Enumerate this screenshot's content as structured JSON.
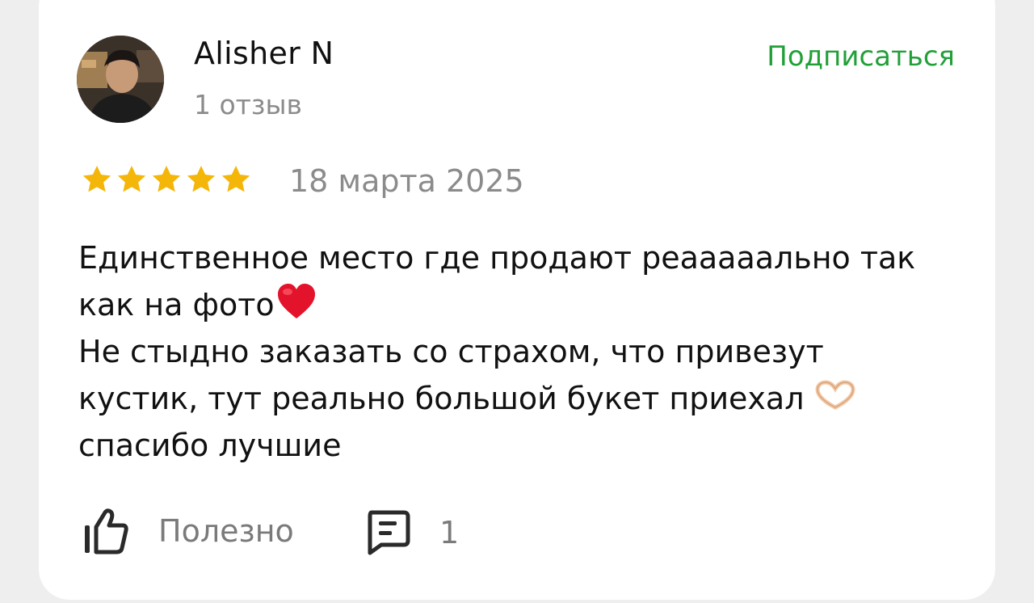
{
  "reviewer": {
    "name": "Alisher N",
    "review_count": "1 отзыв",
    "avatar_icon": "user-photo-avatar"
  },
  "subscribe_label": "Подписаться",
  "rating": {
    "stars": 5,
    "max": 5,
    "date": "18 марта 2025",
    "star_color": "#f5b60a"
  },
  "review": {
    "lines": [
      "Единственное место где продают реааааально так",
      "как на фото",
      "Не стыдно заказать со страхом, что привезут",
      "кустик, тут реально большой букет приехал",
      "спасибо лучшие"
    ],
    "emoji": [
      "heart-emoji",
      "heart-hands-emoji"
    ]
  },
  "actions": {
    "helpful_label": "Полезно",
    "helpful_icon": "thumbs-up-icon",
    "comment_icon": "comment-icon",
    "comment_count": "1"
  },
  "colors": {
    "accent_green": "#21a038",
    "muted_text": "#8b8b8b",
    "card_bg": "#ffffff",
    "page_bg": "#eeeeef"
  }
}
